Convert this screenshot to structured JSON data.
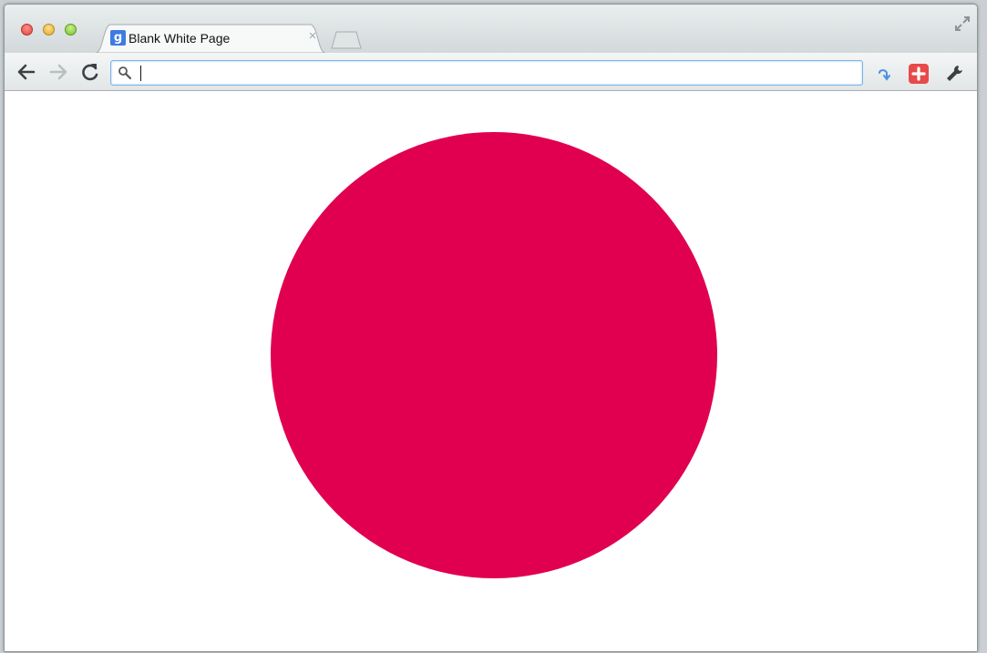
{
  "window": {
    "tab_title": "Blank White Page",
    "favicon_glyph": "g",
    "close_tab_glyph": "×"
  },
  "omnibox": {
    "value": "",
    "placeholder": ""
  },
  "icons": {
    "traffic_close": "close-window-icon",
    "traffic_minimize": "minimize-window-icon",
    "traffic_zoom": "zoom-window-icon",
    "back": "back-arrow-icon",
    "forward": "forward-arrow-icon",
    "reload": "reload-icon",
    "search": "search-icon",
    "extension_1": "blue-hook-icon",
    "extension_2": "red-plus-icon",
    "wrench": "wrench-icon",
    "fullscreen": "fullscreen-icon"
  },
  "colors": {
    "circle": "#e0004f",
    "accent": "#3d7be3",
    "omnibox_border": "#7ab4e8"
  }
}
